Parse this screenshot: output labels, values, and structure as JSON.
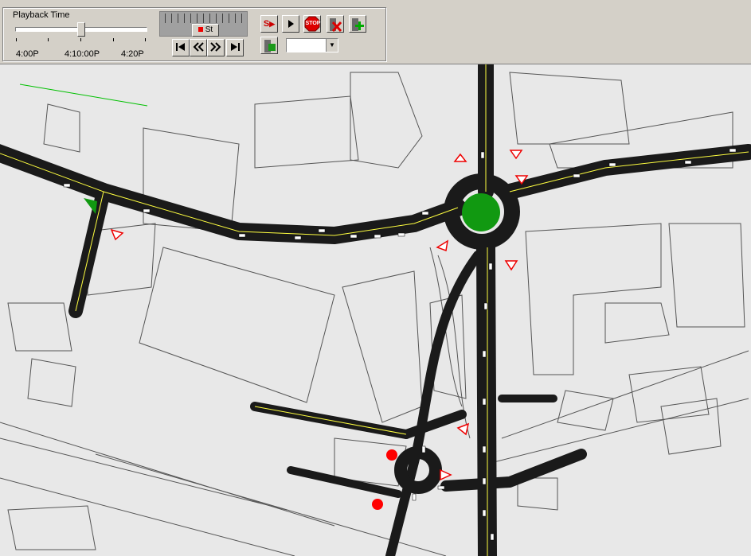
{
  "toolbar": {
    "group_label": "Playback Time",
    "time_labels": [
      "4:00P",
      "4:10:00P",
      "4:20P"
    ],
    "playback_position": 0.5,
    "speed_knob_label": "St",
    "buttons": {
      "step_forward": "S",
      "stop": "STOP"
    },
    "view_select_value": ""
  },
  "colors": {
    "road": "#1a1a1a",
    "lane_marking": "#ffff40",
    "background": "#e8e8e8",
    "roundabout": "#119911",
    "signal": "#ff0000"
  }
}
